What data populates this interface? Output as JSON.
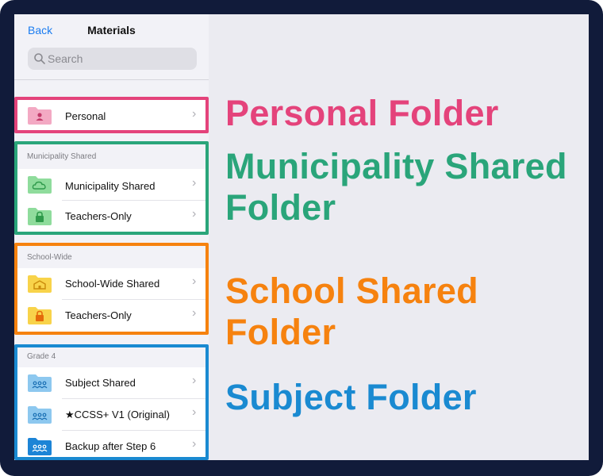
{
  "navbar": {
    "back_label": "Back",
    "title": "Materials"
  },
  "search": {
    "placeholder": "Search"
  },
  "sections": {
    "personal": {
      "header": "",
      "items": [
        {
          "label": "Personal",
          "icon": "person-folder-icon"
        }
      ]
    },
    "municipality": {
      "header": "Municipality Shared",
      "items": [
        {
          "label": "Municipality Shared",
          "icon": "cloud-folder-icon"
        },
        {
          "label": "Teachers-Only",
          "icon": "lock-folder-icon"
        }
      ]
    },
    "school": {
      "header": "School-Wide",
      "items": [
        {
          "label": "School-Wide Shared",
          "icon": "school-folder-icon"
        },
        {
          "label": "Teachers-Only",
          "icon": "lock-folder-icon"
        }
      ]
    },
    "grade": {
      "header": "Grade 4",
      "items": [
        {
          "label": "Subject Shared",
          "icon": "group-folder-icon"
        },
        {
          "label": "★CCSS+ V1 (Original)",
          "icon": "group-folder-icon"
        },
        {
          "label": "Backup after Step 6",
          "icon": "group-folder-icon"
        }
      ]
    }
  },
  "callouts": {
    "personal": "Personal Folder",
    "municipality_line1": "Municipality Shared",
    "municipality_line2": "Folder",
    "school": "School Shared Folder",
    "subject": "Subject Folder"
  },
  "colors": {
    "personal": "#e4437b",
    "municipality": "#2aa57a",
    "school": "#f6820f",
    "subject": "#1a8ad1",
    "frame": "#111b3a",
    "link": "#1a7cf0"
  }
}
